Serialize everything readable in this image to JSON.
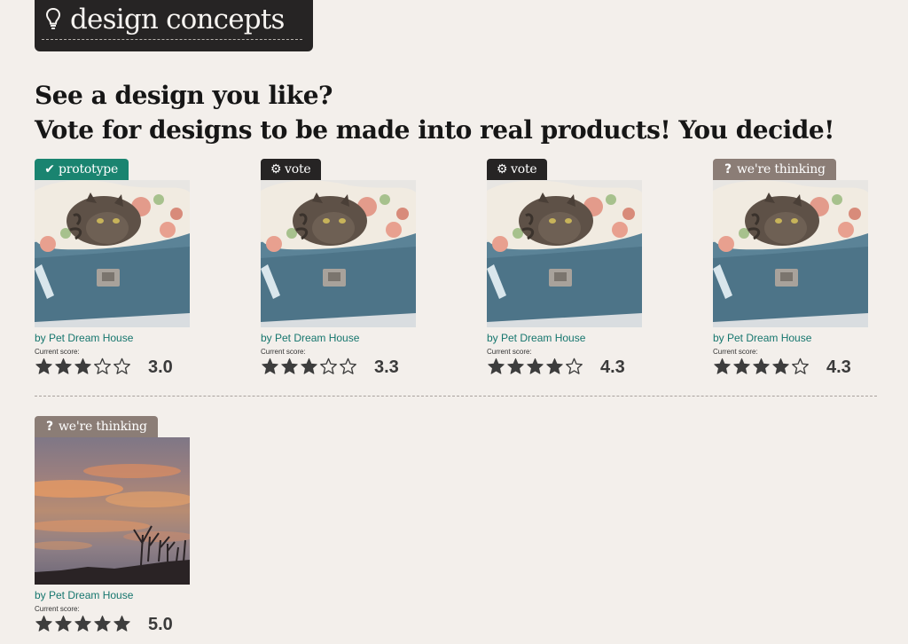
{
  "header": {
    "title": "design concepts",
    "icon": "lightbulb-icon"
  },
  "headline": {
    "line1": "See a design you like?",
    "line2": "Vote for designs to be made into real products! You decide!"
  },
  "colors": {
    "prototype": "#1a8470",
    "vote": "#262424",
    "thinking": "#8b7d76",
    "link": "#16766e"
  },
  "cards": [
    {
      "badge": "prototype",
      "badge_icon": "checkmark-icon",
      "image": "cat-in-suitcase",
      "byline": "by Pet Dream House",
      "score_label": "Current score:",
      "rating": 3,
      "score": "3.0"
    },
    {
      "badge": "vote",
      "badge_icon": "gear-icon",
      "image": "cat-in-suitcase",
      "byline": "by Pet Dream House",
      "score_label": "Current score:",
      "rating": 3,
      "score": "3.3"
    },
    {
      "badge": "vote",
      "badge_icon": "gear-icon",
      "image": "cat-in-suitcase",
      "byline": "by Pet Dream House",
      "score_label": "Current score:",
      "rating": 4,
      "score": "4.3"
    },
    {
      "badge": "we're thinking",
      "badge_icon": "question-icon",
      "image": "cat-in-suitcase",
      "byline": "by Pet Dream House",
      "score_label": "Current score:",
      "rating": 4,
      "score": "4.3"
    },
    {
      "badge": "we're thinking",
      "badge_icon": "question-icon",
      "image": "sunset-sky",
      "byline": "by Pet Dream House",
      "score_label": "Current score:",
      "rating": 5,
      "score": "5.0"
    }
  ]
}
